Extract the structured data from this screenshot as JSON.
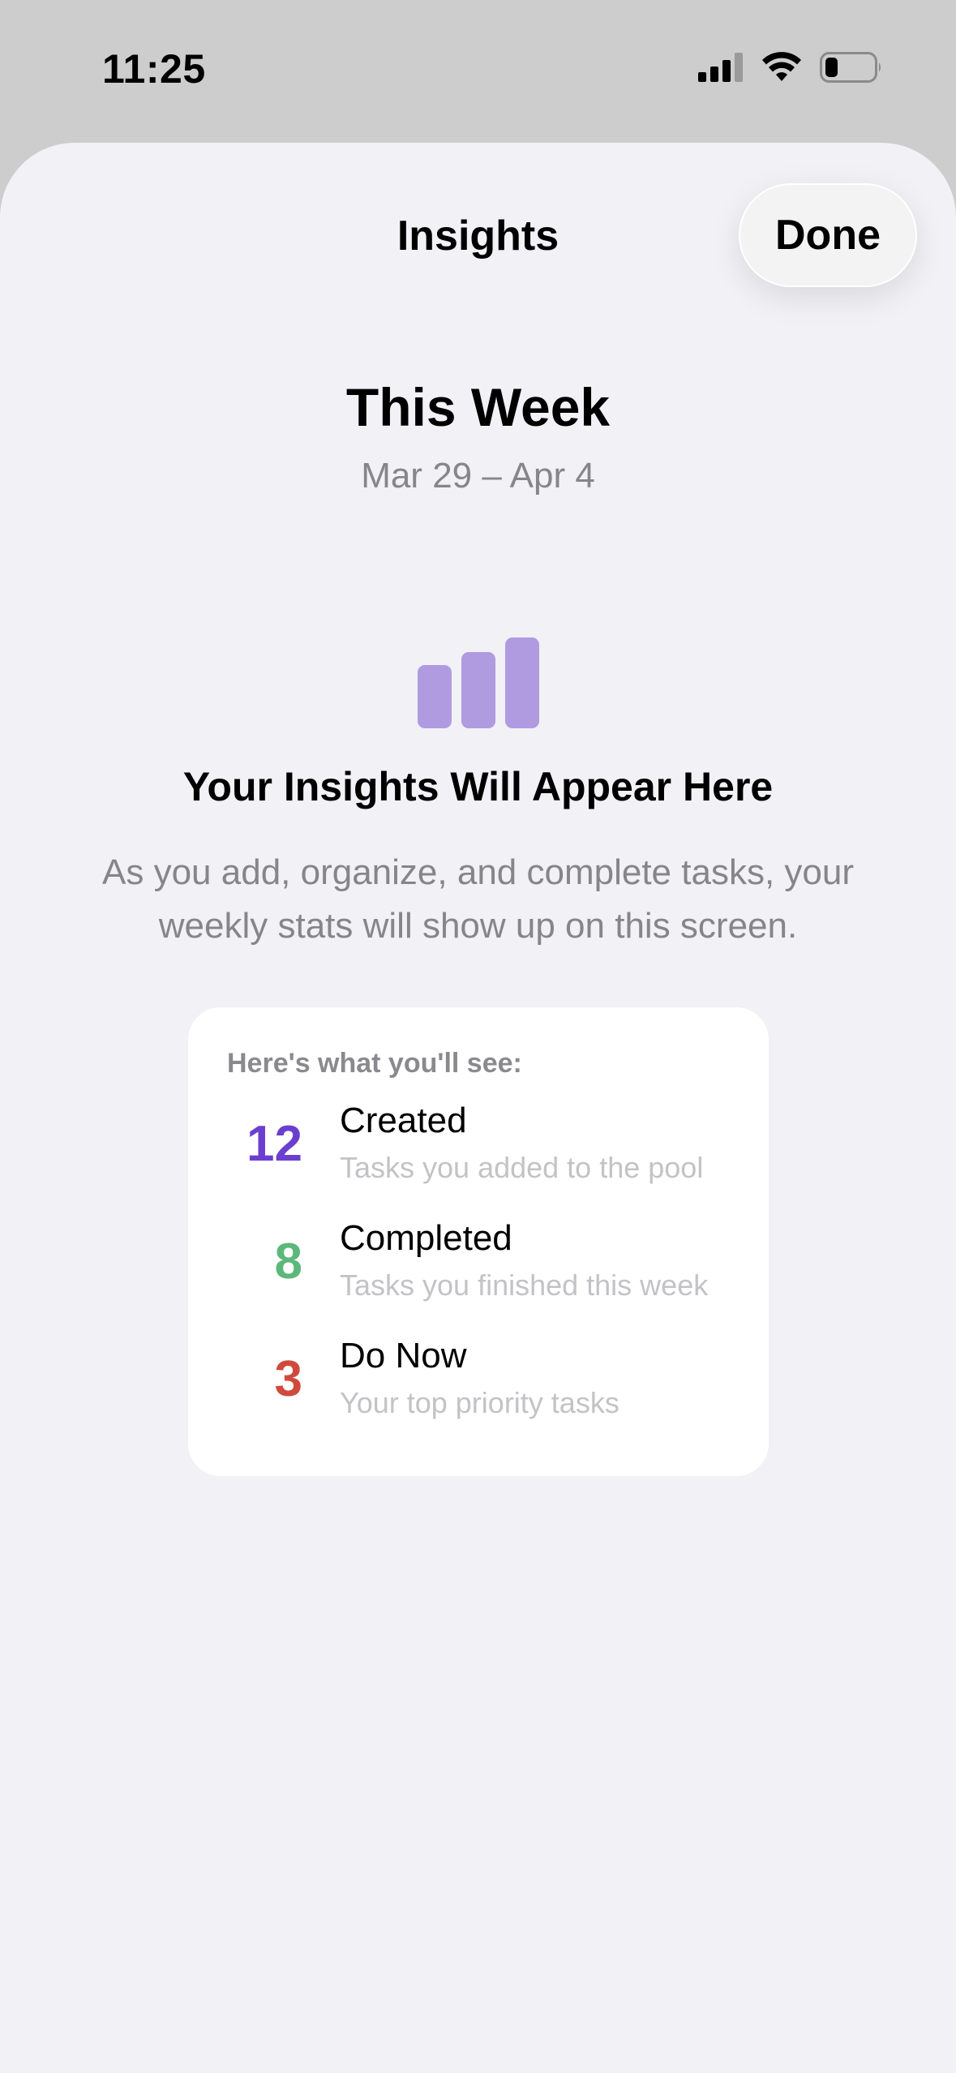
{
  "status_bar": {
    "time": "11:25"
  },
  "nav": {
    "title": "Insights",
    "done_label": "Done"
  },
  "week": {
    "title": "This Week",
    "range": "Mar 29 – Apr 4"
  },
  "empty_state": {
    "icon": "bar-chart-icon",
    "icon_color": "#b09be0",
    "title": "Your Insights Will Appear Here",
    "description_line1": "As you add, organize, and complete tasks, your",
    "description_line2": "weekly stats will show up on this screen."
  },
  "preview_card": {
    "heading": "Here's what you'll see:",
    "items": [
      {
        "number": "12",
        "label": "Created",
        "sublabel": "Tasks you added to the pool",
        "color": "#6a3fd0"
      },
      {
        "number": "8",
        "label": "Completed",
        "sublabel": "Tasks you finished this week",
        "color": "#5cb87a"
      },
      {
        "number": "3",
        "label": "Do Now",
        "sublabel": "Your top priority tasks",
        "color": "#cf4a3d"
      }
    ]
  }
}
